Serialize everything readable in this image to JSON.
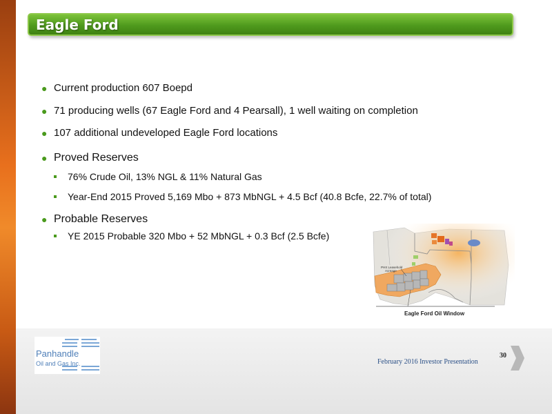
{
  "slide": {
    "title": "Eagle Ford",
    "bullets": [
      {
        "text": "Current production 607 Boepd",
        "sub": []
      },
      {
        "text": "71 producing wells (67 Eagle Ford and 4 Pearsall), 1 well waiting on completion",
        "sub": []
      },
      {
        "text": "107 additional undeveloped Eagle Ford locations",
        "sub": []
      },
      {
        "text": "Proved Reserves",
        "sub": [
          "76% Crude Oil, 13% NGL & 11% Natural Gas",
          "Year-End 2015 Proved 5,169 Mbo + 873 MbNGL + 4.5 Bcf (40.8 Bcfe, 22.7% of total)"
        ]
      },
      {
        "text": "Probable Reserves",
        "sub": [
          "YE 2015 Probable 320 Mbo + 52 MbNGL + 0.3 Bcf (2.5 Bcfe)"
        ]
      }
    ]
  },
  "map": {
    "caption": "Eagle Ford Oil Window",
    "acreage_label_line1": "PHX Leasehold",
    "acreage_label_line2": "Acreage"
  },
  "logo": {
    "name": "Panhandle",
    "subtitle": "Oil and Gas Inc."
  },
  "footer": {
    "presentation": "February 2016 Investor Presentation",
    "page_number": "30"
  },
  "colors": {
    "title_bar": "#4f9a1d",
    "bullet": "#4a9a1d",
    "accent_orange": "#e8701d",
    "footer_text": "#2a4f86"
  }
}
